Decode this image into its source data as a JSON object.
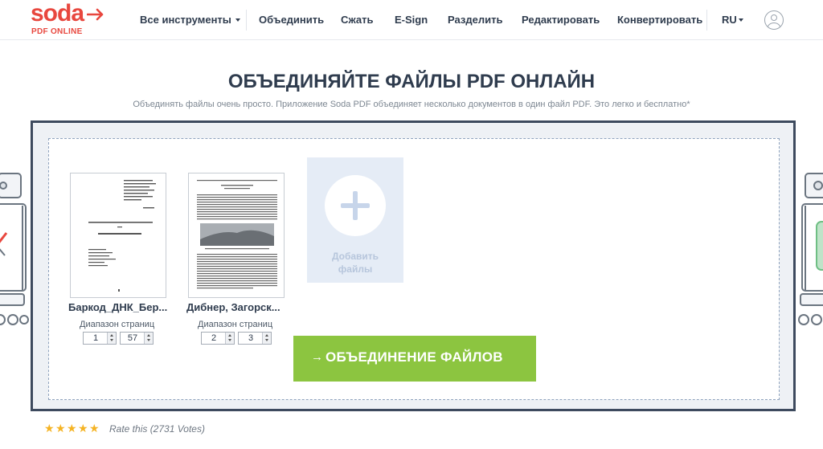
{
  "header": {
    "logo_word": "soda",
    "logo_sub": "PDF ONLINE",
    "nav": {
      "all_tools": "Все инструменты",
      "merge": "Объединить",
      "compress": "Сжать",
      "esign": "E-Sign",
      "split": "Разделить",
      "edit": "Редактировать",
      "convert": "Конвертировать"
    },
    "language": "RU",
    "user_icon": "user-icon"
  },
  "page": {
    "title": "ОБЪЕДИНЯЙТЕ ФАЙЛЫ PDF ОНЛАЙН",
    "subtitle": "Объединять файлы очень просто. Приложение Soda PDF объединяет несколько документов в один файл PDF. Это легко и бесплатно*"
  },
  "files": [
    {
      "name": "Баркод_ДНК_Бер...",
      "range_label": "Диапазон страниц",
      "from": "1",
      "to": "57"
    },
    {
      "name": "Дибнер, Загорск...",
      "range_label": "Диапазон страниц",
      "from": "2",
      "to": "3"
    }
  ],
  "add_files": {
    "line1": "Добавить",
    "line2": "файлы",
    "icon": "plus-icon"
  },
  "merge_button": {
    "arrow": "→",
    "label": "ОБЪЕДИНЕНИЕ ФАЙЛОВ"
  },
  "rating": {
    "stars": 5,
    "text": "Rate this (2731 Votes)"
  },
  "colors": {
    "brand_red": "#e8473e",
    "panel_border": "#3d4a5e",
    "merge_green": "#8cc540",
    "add_files_bg": "#e5ecf6",
    "star": "#f5b323"
  }
}
